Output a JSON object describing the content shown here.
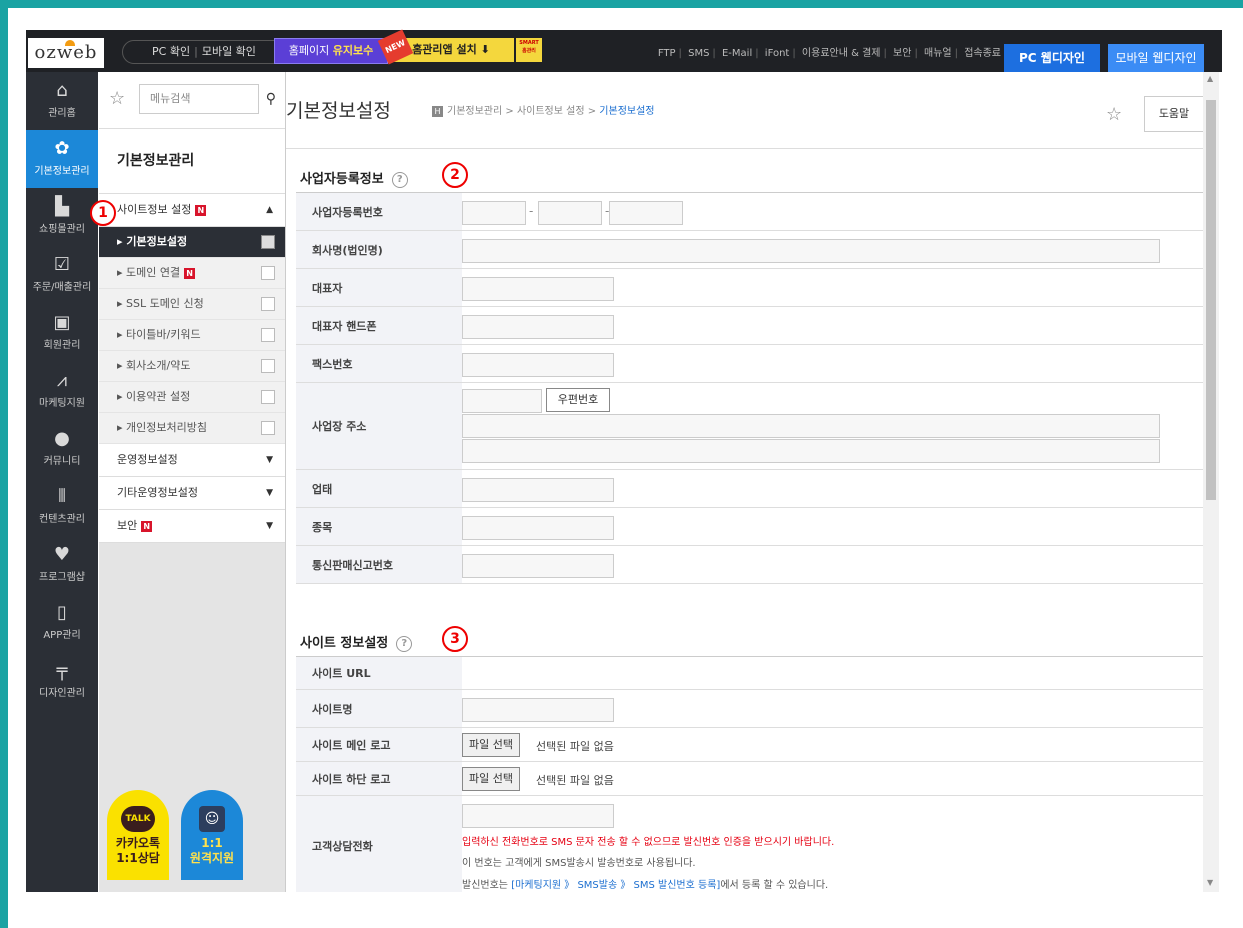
{
  "topbar": {
    "logo": "ozweb",
    "view_pc": "PC 확인",
    "view_mobile": "모바일 확인",
    "maint_prefix": "홈페이지",
    "maint_highlight": "유지보수",
    "new_tag": "NEW",
    "app_install": "홈관리앱 설치 ⬇",
    "smart_label": "SMART 홈관리",
    "utils": [
      "FTP",
      "SMS",
      "E-Mail",
      "iFont",
      "이용료안내 & 결제",
      "보안",
      "매뉴얼",
      "접속종료"
    ],
    "tab_pc": "PC 웹디자인",
    "tab_mobile": "모바일 웹디자인"
  },
  "leftnav": [
    {
      "label": "관리홈",
      "icon": "home-icon"
    },
    {
      "label": "기본정보관리",
      "icon": "gear-icon",
      "active": true
    },
    {
      "label": "쇼핑몰관리",
      "icon": "cart-icon"
    },
    {
      "label": "주문/매출관리",
      "icon": "clipboard-check-icon"
    },
    {
      "label": "회원관리",
      "icon": "member-card-icon"
    },
    {
      "label": "마케팅지원",
      "icon": "chart-line-icon"
    },
    {
      "label": "커뮤니티",
      "icon": "chat-bubble-icon"
    },
    {
      "label": "컨텐츠관리",
      "icon": "books-icon"
    },
    {
      "label": "프로그램샵",
      "icon": "heart-icon"
    },
    {
      "label": "APP관리",
      "icon": "mobile-icon"
    },
    {
      "label": "디자인관리",
      "icon": "paint-roller-icon"
    }
  ],
  "submenu": {
    "search_placeholder": "메뉴검색",
    "title": "기본정보관리",
    "group1": "사이트정보 설정",
    "group1_badge": "N",
    "items": [
      {
        "label": "▸ 기본정보설정",
        "active": true
      },
      {
        "label": "▸ 도메인 연결",
        "badge": "N"
      },
      {
        "label": "▸ SSL 도메인 신청"
      },
      {
        "label": "▸ 타이틀바/키워드"
      },
      {
        "label": "▸ 회사소개/약도"
      },
      {
        "label": "▸ 이용약관 설정"
      },
      {
        "label": "▸ 개인정보처리방침"
      }
    ],
    "group2": "운영정보설정",
    "group3": "기타운영정보설정",
    "group4": "보안",
    "group4_badge": "N",
    "kakao_label1": "카카오톡",
    "kakao_label2": "1:1상담",
    "kakao_icon": "TALK",
    "remote_label1": "1:1",
    "remote_label2": "원격지원"
  },
  "header": {
    "title": "기본정보설정",
    "crumb_h": "H",
    "crumb1": "기본정보관리",
    "crumb2": "사이트정보 설정",
    "crumb3": "기본정보설정",
    "help": "도움말"
  },
  "markers": {
    "m1": "1",
    "m2": "2",
    "m3": "3"
  },
  "business": {
    "title": "사업자등록정보",
    "rows": {
      "reg_no": "사업자등록번호",
      "company": "회사명(법인명)",
      "ceo": "대표자",
      "ceo_phone": "대표자 핸드폰",
      "fax": "팩스번호",
      "address": "사업장 주소",
      "zip_button": "우편번호",
      "biz_type": "업태",
      "biz_item": "종목",
      "mail_order_no": "통신판매신고번호"
    }
  },
  "site": {
    "title": "사이트 정보설정",
    "rows": {
      "url": "사이트 URL",
      "name": "사이트명",
      "main_logo": "사이트 메인 로고",
      "footer_logo": "사이트 하단 로고",
      "cs_phone": "고객상담전화"
    },
    "file_button": "파일 선택",
    "file_none": "선택된 파일 없음",
    "note_red": "입력하신 전화번호로 SMS 문자 전송 할 수 없으므로 발신번호 인증을 받으시기 바랍니다.",
    "note_1": "이 번호는 고객에게 SMS발송시 발송번호로 사용됩니다.",
    "note_2_prefix": "발신번호는 ",
    "note_2_link": "[마케팅지원 》 SMS발송 》 SMS 발신번호 등록]",
    "note_2_suffix": "에서 등록 할 수 있습니다."
  }
}
